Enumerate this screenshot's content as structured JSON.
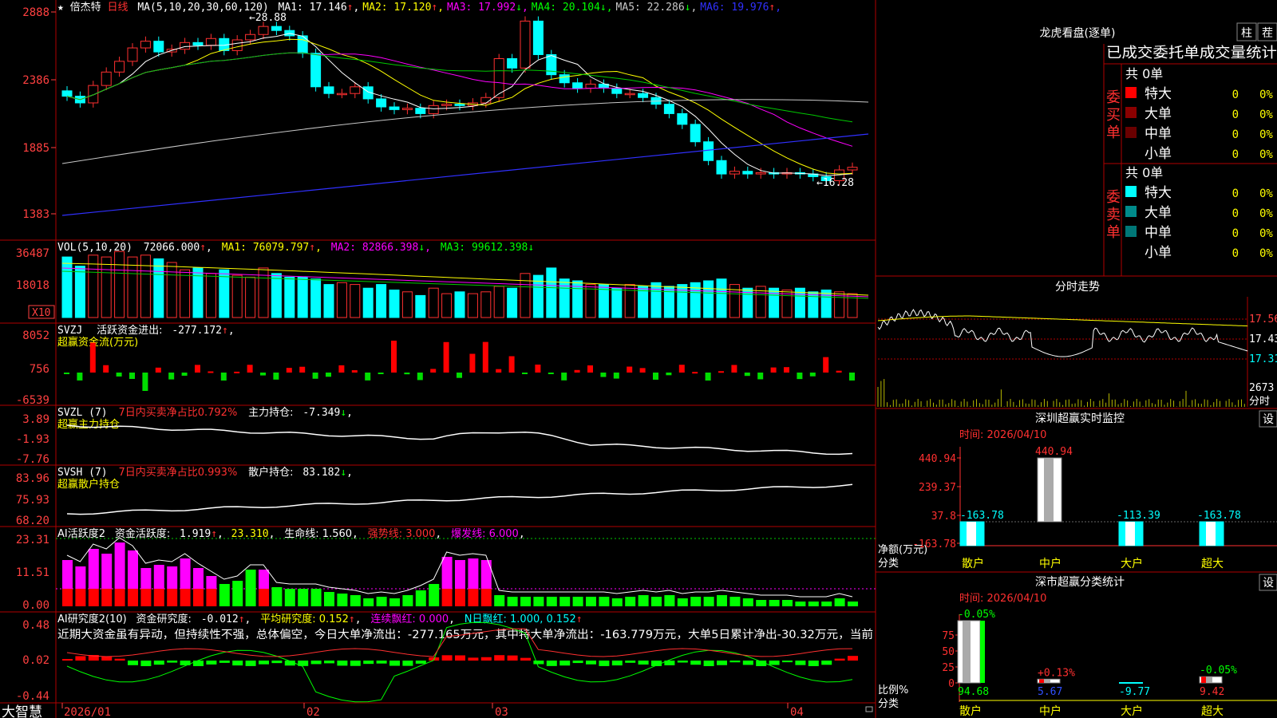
{
  "stock": {
    "star": "★",
    "name": "倍杰特",
    "period": "日线"
  },
  "ma_title": "MA(5,10,20,30,60,120)",
  "ma_values": [
    {
      "label": "MA1:",
      "value": "17.146",
      "arrow": "↑",
      "color": "#ffffff"
    },
    {
      "label": "MA2:",
      "value": "17.120",
      "arrow": "↑",
      "color": "#ffff00"
    },
    {
      "label": "MA3:",
      "value": "17.992",
      "arrow": "↓",
      "color": "#ff00ff"
    },
    {
      "label": "MA4:",
      "value": "20.104",
      "arrow": "↓",
      "color": "#00ff00"
    },
    {
      "label": "MA5:",
      "value": "22.286",
      "arrow": "↓",
      "color": "#c8c8c8"
    },
    {
      "label": "MA6:",
      "value": "19.976",
      "arrow": "↑",
      "color": "#3030ff"
    }
  ],
  "price_axis": [
    "2888",
    "2386",
    "1885",
    "1383"
  ],
  "price_hi_label": "28.88",
  "price_lo_label": "16.28",
  "vol": {
    "title": "VOL(5,10,20)",
    "value": "72066.000",
    "ma1": "MA1: 76079.797",
    "ma2": "MA2: 82866.398",
    "ma3": "MA3: 99612.398",
    "axis": [
      "36487",
      "18018"
    ],
    "unit": "X10"
  },
  "svzj": {
    "title": "SVZJ",
    "label": "活跃资金进出:",
    "value": "-277.172",
    "subtitle": "超赢资金流(万元)",
    "axis": [
      "8052",
      "756",
      "-6539"
    ]
  },
  "svzl": {
    "title": "SVZL (7)",
    "ratio": "7日内买卖净占比0.792%",
    "label": "主力持仓:",
    "value": "-7.349",
    "subtitle": "超赢主力持仓",
    "axis": [
      "3.89",
      "-1.93",
      "-7.76"
    ]
  },
  "svsh": {
    "title": "SVSH (7)",
    "ratio": "7日内买卖净占比0.993%",
    "label": "散户持仓:",
    "value": "83.182",
    "subtitle": "超赢散户持仓",
    "axis": [
      "83.96",
      "75.93",
      "68.20"
    ]
  },
  "ai1": {
    "title": "AI活跃度2",
    "label": "资金活跃度:",
    "value": "1.919",
    "v2": "23.310",
    "life": "生命线: 1.560",
    "strong": "强势线: 3.000",
    "burst": "爆发线: 6.000",
    "axis": [
      "23.31",
      "11.51",
      "0.00"
    ]
  },
  "ai2": {
    "title": "AI研究度2(10)",
    "label": "资金研究度:",
    "value": "-0.012",
    "avg": "平均研究度: 0.152",
    "red": "连续飘红: 0.000",
    "nred": "N日飘红: 1.000, 0.152",
    "axis": [
      "0.48",
      "0.02",
      "-0.44"
    ],
    "comment": "近期大资金虽有异动，但持续性不强，总体偏空，今日大单净流出：-277.165万元，其中特大单净流出：-163.779万元，大单5日累计净出-30.32万元，当前"
  },
  "xaxis": {
    "brand": "大智慧",
    "labels": [
      "2026/01",
      "02",
      "03",
      "04"
    ]
  },
  "lhb": {
    "title": "龙虎看盘(逐单)",
    "btn1": "柱",
    "btn2": "茬",
    "header": "已成交委托单成交量统计",
    "buy_label": "委买单",
    "sell_label": "委卖单",
    "buy_total": "共 0单",
    "sell_total": "共 0单",
    "buy_rows": [
      {
        "name": "特大",
        "val": "0",
        "pct": "0%",
        "color": "#ff0000"
      },
      {
        "name": "大单",
        "val": "0",
        "pct": "0%",
        "color": "#8b0000"
      },
      {
        "name": "中单",
        "val": "0",
        "pct": "0%",
        "color": "#6a0000"
      },
      {
        "name": "小单",
        "val": "0",
        "pct": "0%",
        "color": ""
      }
    ],
    "sell_rows": [
      {
        "name": "特大",
        "val": "0",
        "pct": "0%",
        "color": "#00ffff"
      },
      {
        "name": "大单",
        "val": "0",
        "pct": "0%",
        "color": "#008b8b"
      },
      {
        "name": "中单",
        "val": "0",
        "pct": "0%",
        "color": "#007777"
      },
      {
        "name": "小单",
        "val": "0",
        "pct": "0%",
        "color": ""
      }
    ]
  },
  "intraday": {
    "title": "分时走势",
    "price_labels": [
      "17.56",
      "17.43",
      "17.31"
    ],
    "vol_label": "2673",
    "unit": "分时"
  },
  "sz_monitor": {
    "title": "深圳超赢实时监控",
    "btn": "设",
    "time": "时间: 2026/04/10",
    "axis": [
      "440.94",
      "239.37",
      "37.8",
      "-163.78"
    ],
    "ylabel": "净额(万元)",
    "xlabel": "分类",
    "categories": [
      "散户",
      "中户",
      "大户",
      "超大"
    ],
    "value_labels": [
      "-163.78",
      "440.94",
      "-113.39",
      "-163.78"
    ]
  },
  "sz_stats": {
    "title": "深市超赢分类统计",
    "btn": "设",
    "time": "时间: 2026/04/10",
    "axis": [
      "75",
      "50",
      "25",
      "0"
    ],
    "ylabel": "比例%",
    "xlabel": "分类",
    "categories": [
      "散户",
      "中户",
      "大户",
      "超大"
    ],
    "top_labels": [
      "-0.05%",
      "+0.13%",
      "",
      "-0.05%"
    ],
    "bottom_labels": [
      "94.68",
      "5.67",
      "-9.77",
      "9.42"
    ]
  },
  "chart_data": [
    {
      "type": "bar",
      "title": "深圳超赢实时监控",
      "ylabel": "净额(万元)",
      "xlabel": "分类",
      "categories": [
        "散户",
        "中户",
        "大户",
        "超大"
      ],
      "values": [
        -163.78,
        440.94,
        -113.39,
        -163.78
      ],
      "ylim": [
        -163.78,
        440.94
      ]
    },
    {
      "type": "bar",
      "title": "深市超赢分类统计",
      "ylabel": "比例%",
      "xlabel": "分类",
      "categories": [
        "散户",
        "中户",
        "大户",
        "超大"
      ],
      "values": [
        94.68,
        5.67,
        -9.77,
        9.42
      ],
      "ylim": [
        0,
        94.68
      ]
    }
  ],
  "colors": {
    "up": "#ff3030",
    "down": "#00ffff",
    "frame": "#b00000",
    "magenta": "#ff00ff",
    "green": "#00ff00"
  }
}
